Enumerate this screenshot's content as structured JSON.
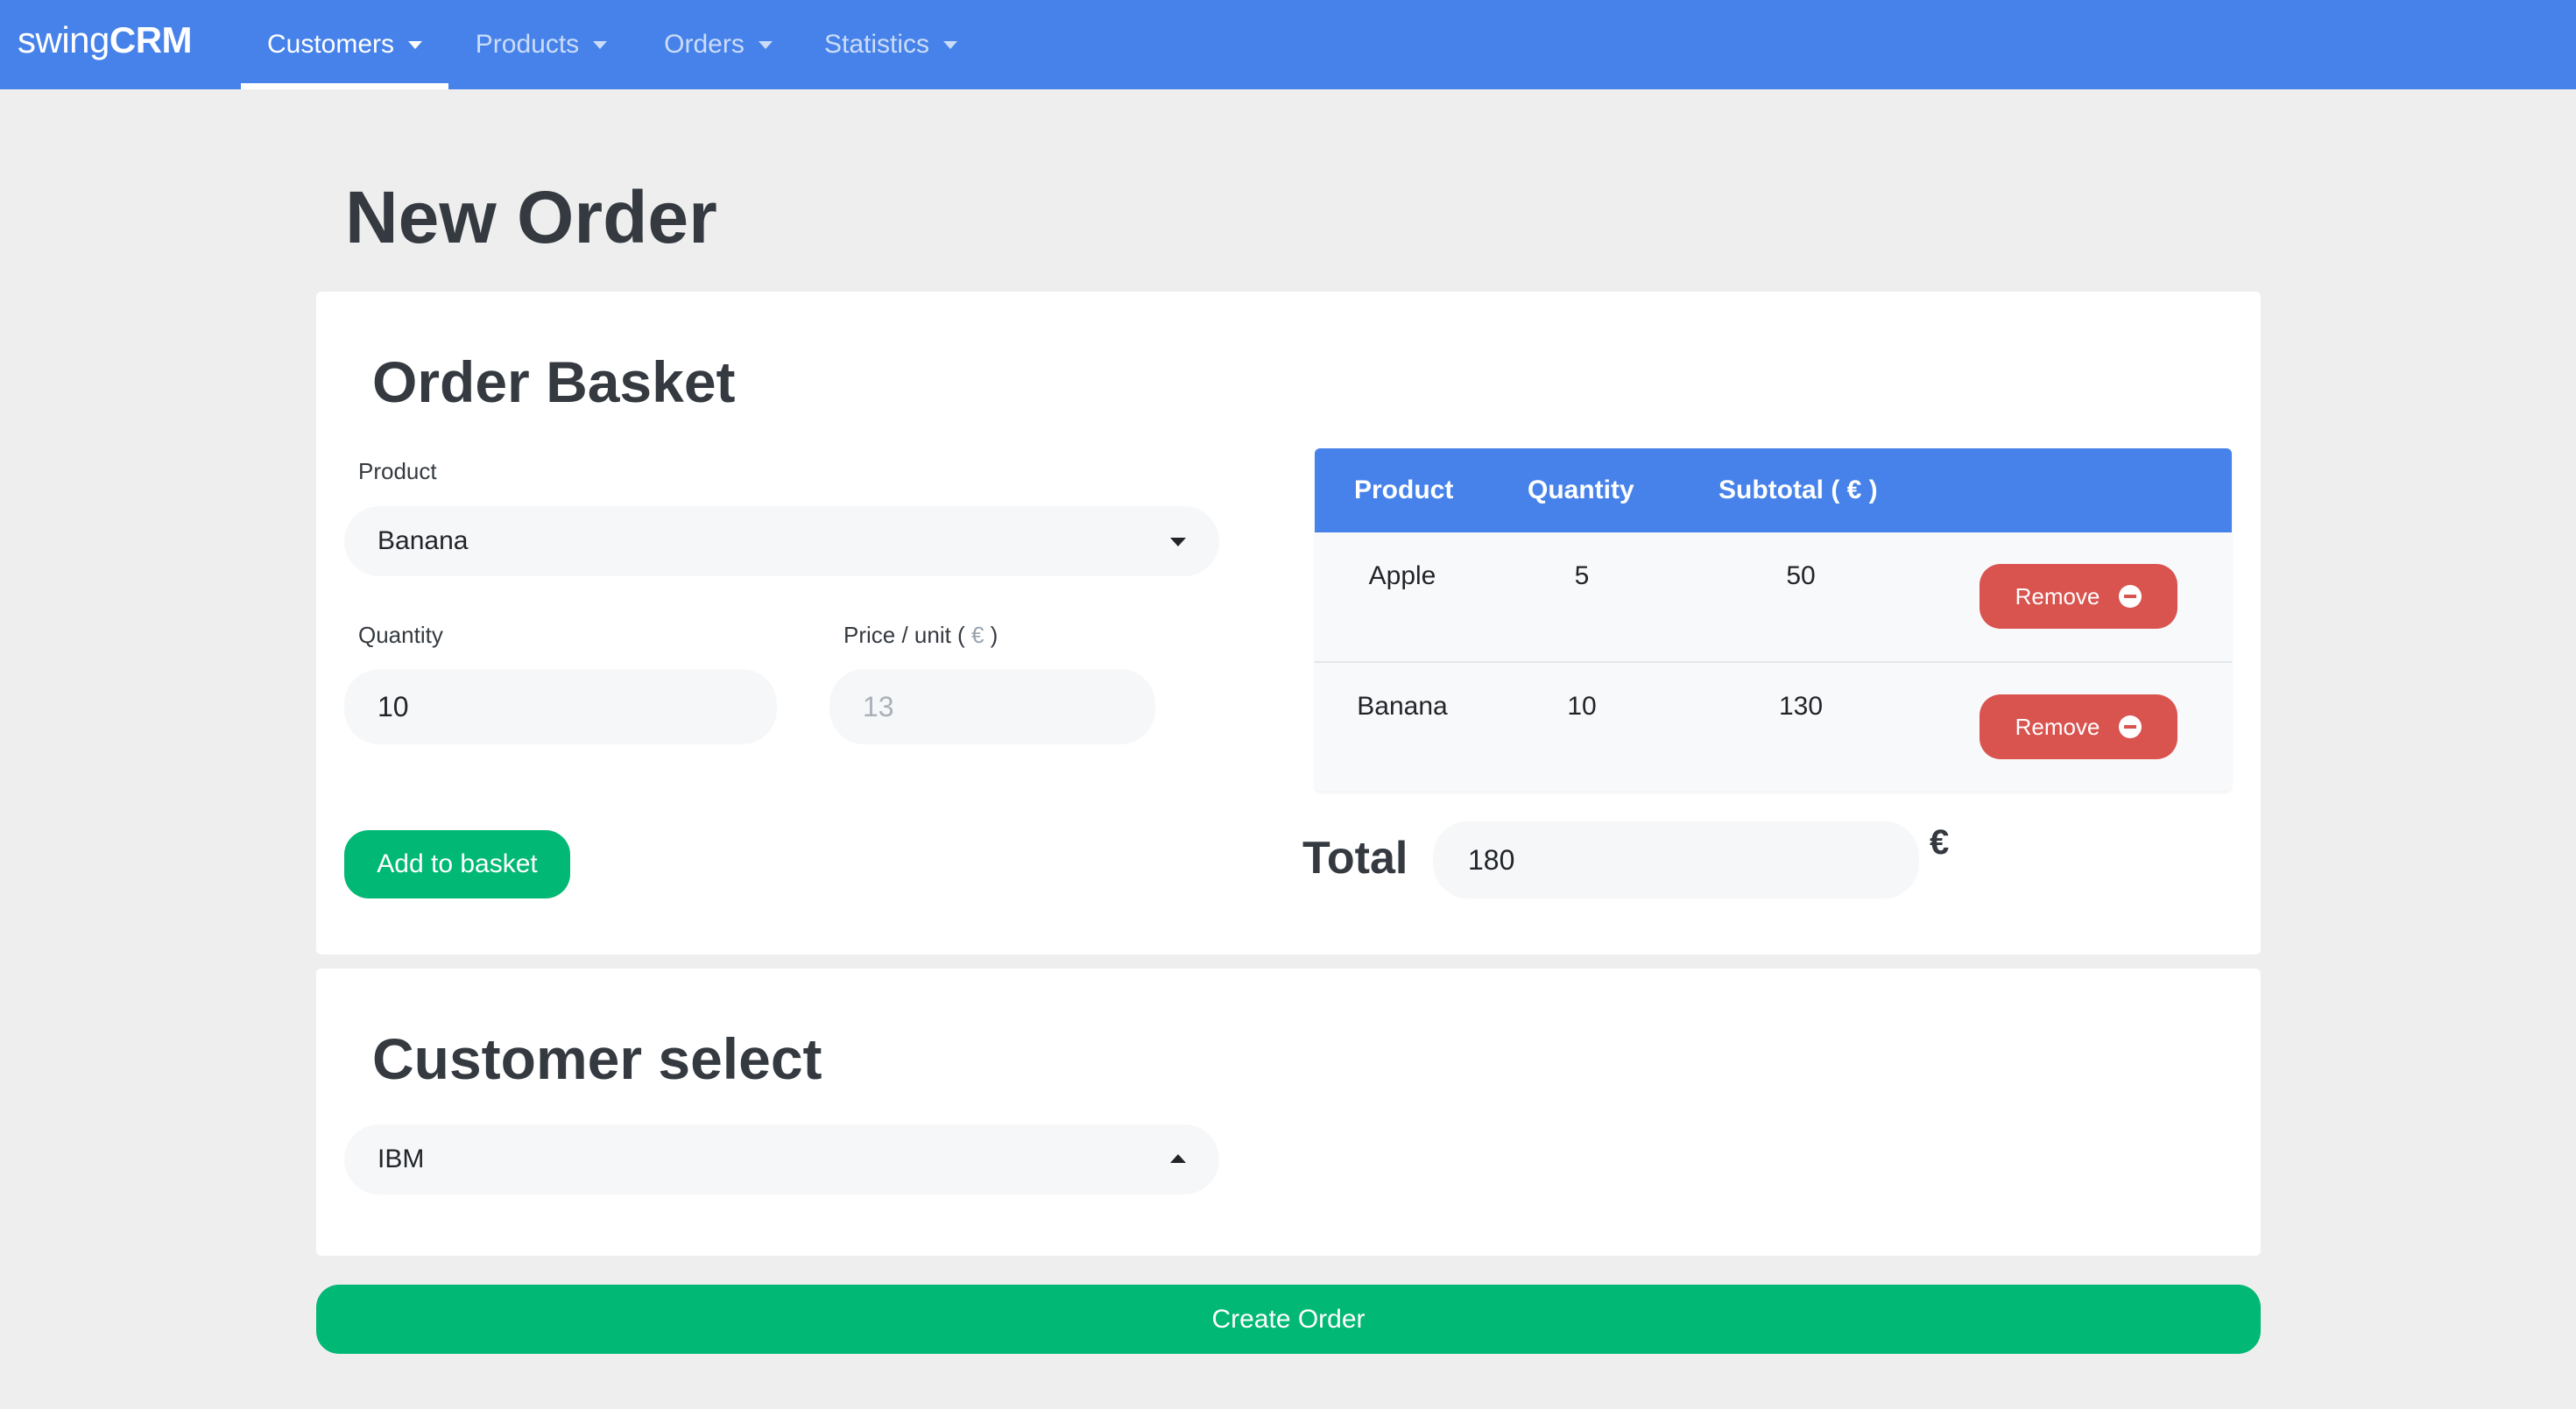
{
  "navbar": {
    "brand_light": "swing",
    "brand_bold": "CRM",
    "items": [
      {
        "label": "Customers"
      },
      {
        "label": "Products"
      },
      {
        "label": "Orders"
      },
      {
        "label": "Statistics"
      }
    ],
    "active_item": "Customers"
  },
  "page": {
    "title": "New Order"
  },
  "basket": {
    "title": "Order Basket",
    "product_label": "Product",
    "product_value": "Banana",
    "quantity_label": "Quantity",
    "quantity_value": "10",
    "price_label_prefix": "Price / unit (",
    "price_label_currency": " € ",
    "price_label_suffix": ")",
    "price_value": "13",
    "add_button": "Add to basket",
    "table": {
      "headers": [
        "Product",
        "Quantity",
        "Subtotal ( € )"
      ],
      "rows": [
        {
          "product": "Apple",
          "quantity": "5",
          "subtotal": "50",
          "action": "Remove"
        },
        {
          "product": "Banana",
          "quantity": "10",
          "subtotal": "130",
          "action": "Remove"
        }
      ]
    },
    "total_label": "Total",
    "total_value": "180",
    "currency": "€"
  },
  "customer": {
    "title": "Customer select",
    "selected": "IBM"
  },
  "create_button": "Create Order",
  "colors": {
    "navbar": "#4682e9",
    "background": "#eeeeee",
    "green": "#02b875",
    "danger": "#d9534f"
  }
}
